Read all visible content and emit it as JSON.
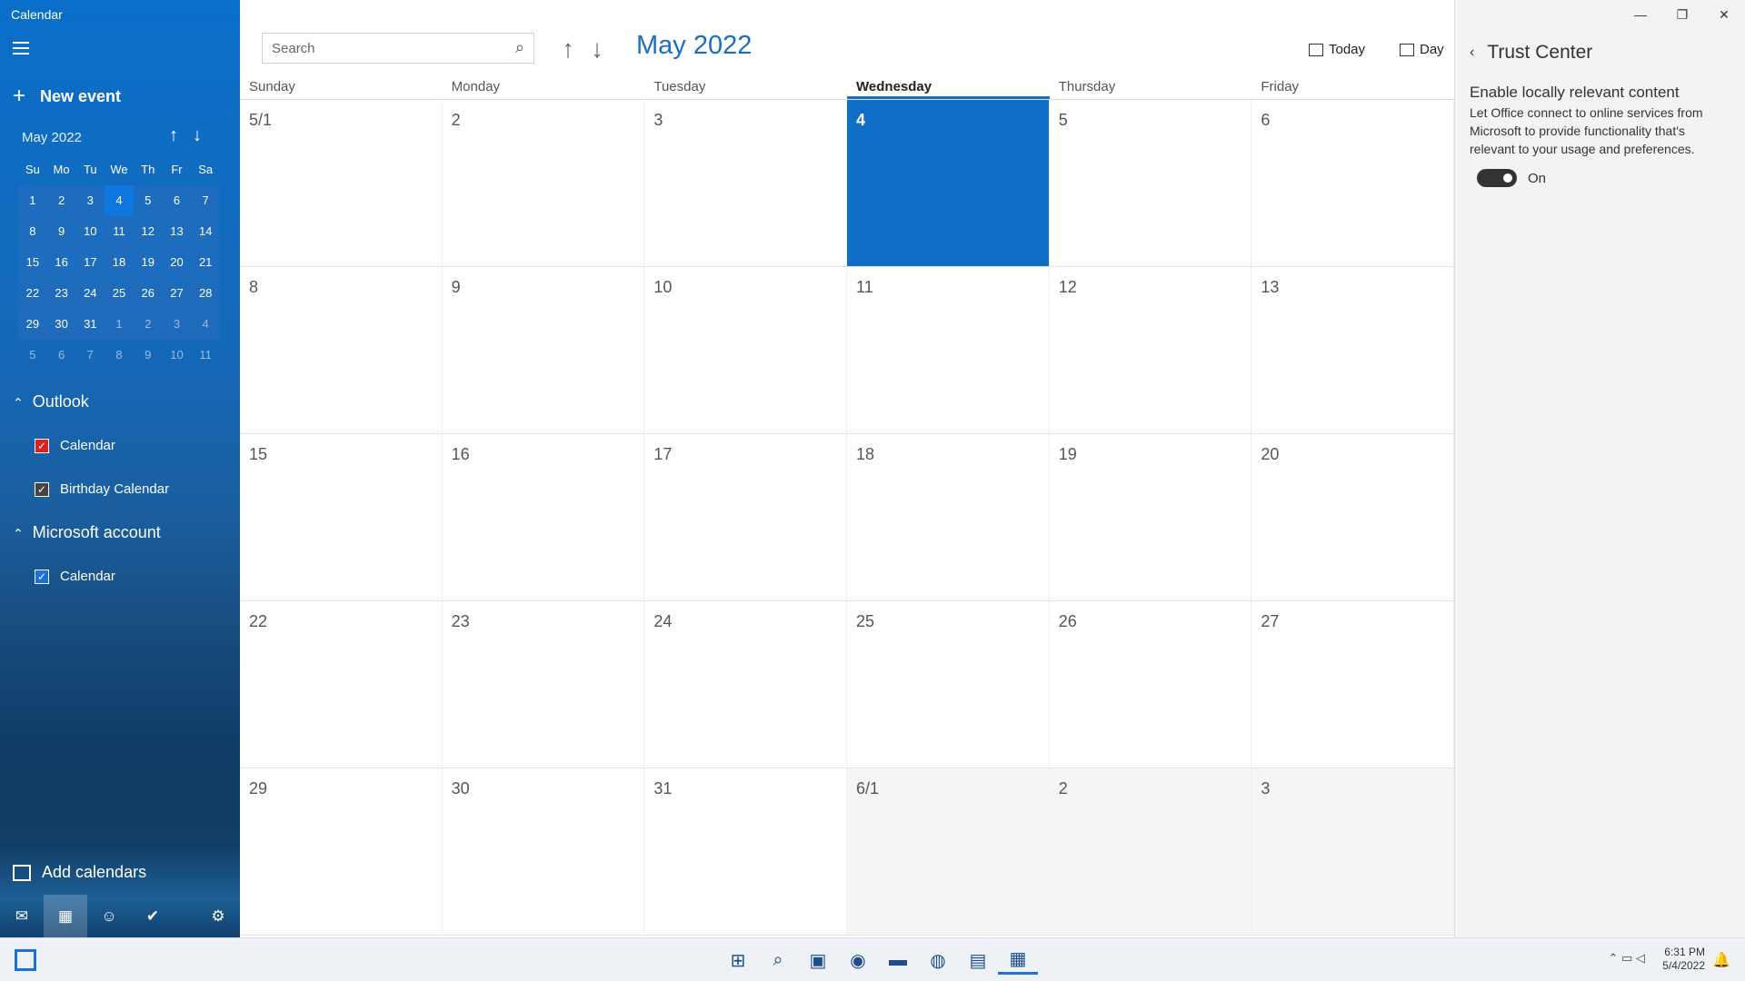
{
  "app": {
    "title": "Calendar"
  },
  "sidebar": {
    "new_event": "New event",
    "mini_month": "May 2022",
    "dow": [
      "Su",
      "Mo",
      "Tu",
      "We",
      "Th",
      "Fr",
      "Sa"
    ],
    "weeks": [
      [
        "1",
        "2",
        "3",
        "4",
        "5",
        "6",
        "7"
      ],
      [
        "8",
        "9",
        "10",
        "11",
        "12",
        "13",
        "14"
      ],
      [
        "15",
        "16",
        "17",
        "18",
        "19",
        "20",
        "21"
      ],
      [
        "22",
        "23",
        "24",
        "25",
        "26",
        "27",
        "28"
      ],
      [
        "29",
        "30",
        "31",
        "1",
        "2",
        "3",
        "4"
      ],
      [
        "5",
        "6",
        "7",
        "8",
        "9",
        "10",
        "11"
      ]
    ],
    "outlook": "Outlook",
    "outlook_calendar": "Calendar",
    "birthday_calendar": "Birthday Calendar",
    "microsoft_account": "Microsoft account",
    "ms_calendar": "Calendar",
    "add_calendars": "Add calendars"
  },
  "header": {
    "search_placeholder": "Search",
    "month": "May 2022",
    "today": "Today",
    "day": "Day"
  },
  "grid": {
    "dow": [
      "Sunday",
      "Monday",
      "Tuesday",
      "Wednesday",
      "Thursday",
      "Friday"
    ],
    "weeks": [
      [
        "5/1",
        "2",
        "3",
        "4",
        "5",
        "6"
      ],
      [
        "8",
        "9",
        "10",
        "11",
        "12",
        "13"
      ],
      [
        "15",
        "16",
        "17",
        "18",
        "19",
        "20"
      ],
      [
        "22",
        "23",
        "24",
        "25",
        "26",
        "27"
      ],
      [
        "29",
        "30",
        "31",
        "6/1",
        "2",
        "3"
      ]
    ]
  },
  "panel": {
    "title": "Trust Center",
    "setting_title": "Enable locally relevant content",
    "setting_desc": "Let Office connect to online services from Microsoft to provide functionality that's relevant to your usage and preferences.",
    "toggle_state": "On"
  },
  "taskbar": {
    "time": "6:31 PM",
    "date": "5/4/2022"
  }
}
